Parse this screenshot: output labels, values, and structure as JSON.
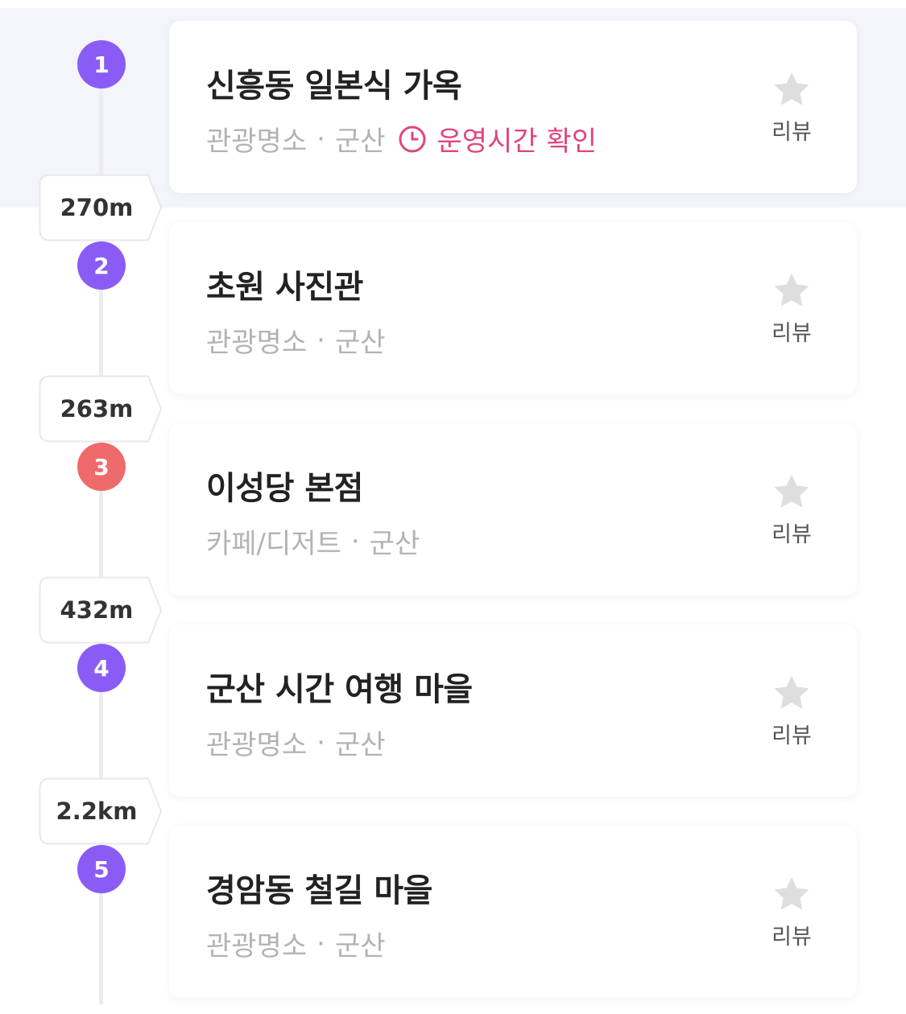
{
  "colors": {
    "purple": "#8a5cf5",
    "red": "#ef6b6b",
    "pink": "#e0457b",
    "star": "#dedede"
  },
  "stops": [
    {
      "number": "1",
      "badge_color": "purple",
      "name": "신흥동 일본식 가옥",
      "category": "관광명소",
      "separator": "·",
      "region": "군산",
      "hours_label": "운영시간 확인",
      "hours_icon": "clock-icon",
      "review_icon": "star-icon",
      "review_label": "리뷰",
      "distance_to_next": "270m"
    },
    {
      "number": "2",
      "badge_color": "purple",
      "name": "초원 사진관",
      "category": "관광명소",
      "separator": "·",
      "region": "군산",
      "review_icon": "star-icon",
      "review_label": "리뷰",
      "distance_to_next": "263m"
    },
    {
      "number": "3",
      "badge_color": "red",
      "name": "이성당 본점",
      "category": "카페/디저트",
      "separator": "·",
      "region": "군산",
      "review_icon": "star-icon",
      "review_label": "리뷰",
      "distance_to_next": "432m"
    },
    {
      "number": "4",
      "badge_color": "purple",
      "name": "군산 시간 여행 마을",
      "category": "관광명소",
      "separator": "·",
      "region": "군산",
      "review_icon": "star-icon",
      "review_label": "리뷰",
      "distance_to_next": "2.2km"
    },
    {
      "number": "5",
      "badge_color": "purple",
      "name": "경암동 철길 마을",
      "category": "관광명소",
      "separator": "·",
      "region": "군산",
      "review_icon": "star-icon",
      "review_label": "리뷰"
    }
  ]
}
